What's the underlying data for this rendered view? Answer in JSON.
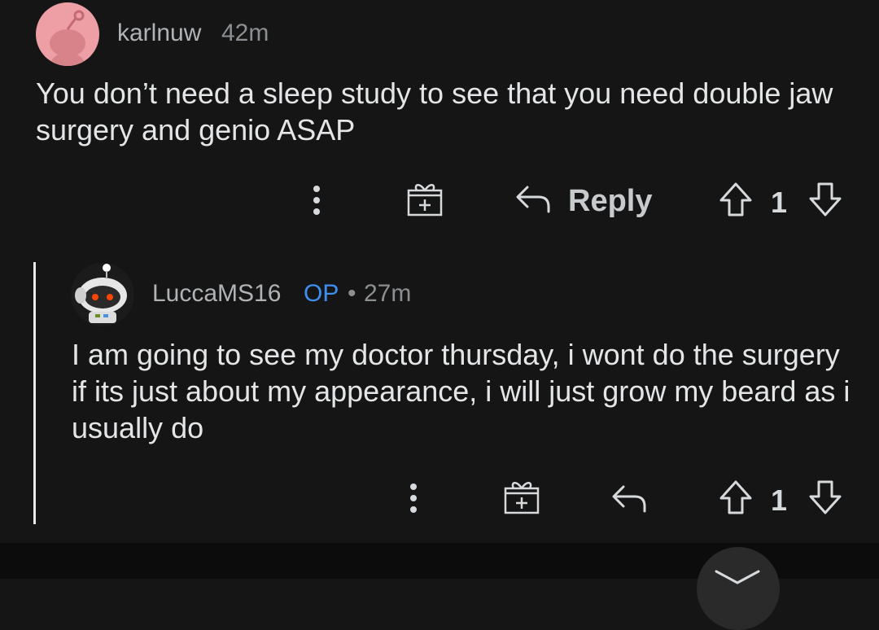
{
  "comments": [
    {
      "username": "karlnuw",
      "time": "42m",
      "body": "You don’t need a sleep study to see that you need double jaw surgery and genio ASAP",
      "actions": {
        "reply_label": "Reply",
        "votes": "1"
      },
      "avatar": {
        "icon": "snoo-avatar-pink",
        "bg": "#ee9fa6"
      }
    },
    {
      "username": "LuccaMS16",
      "op_badge": "OP",
      "separator": "•",
      "time": "27m",
      "body": "I am going to see my doctor thursday, i wont do the surgery if its just about my appearance, i will just grow my beard as i usually do",
      "actions": {
        "votes": "1"
      },
      "avatar": {
        "icon": "snoo-astronaut-avatar",
        "bg": "#1b1b1b"
      }
    }
  ],
  "colors": {
    "background": "#151515",
    "text": "#e3e5e7",
    "op": "#3d8ef0",
    "muted": "#8c8f92"
  },
  "icons": [
    "more-icon",
    "award-icon",
    "reply-icon",
    "upvote-icon",
    "downvote-icon",
    "chevron-down-icon"
  ]
}
